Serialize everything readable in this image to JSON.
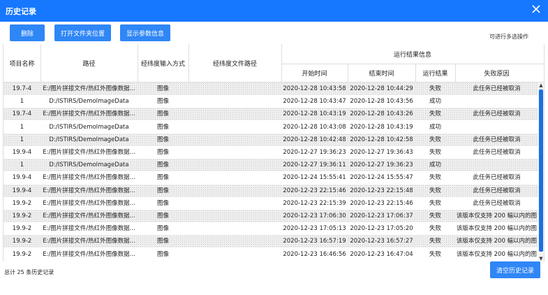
{
  "window": {
    "title": "历史记录",
    "close_icon": "close-icon"
  },
  "toolbar": {
    "delete_label": "删除",
    "open_folder_label": "打开文件夹位置",
    "show_params_label": "显示参数信息",
    "hint": "可进行多选操作"
  },
  "table": {
    "headers": {
      "project_name": "项目名称",
      "path": "路径",
      "latlon_input": "经纬度输入方式",
      "latlon_file": "经纬度文件路径",
      "result_group": "运行结果信息",
      "start_time": "开始时间",
      "end_time": "结束时间",
      "result": "运行结果",
      "failure_reason": "失败原因"
    },
    "rows": [
      {
        "name": "19.7-4",
        "path": "E:/图片拼接文件/热红外图像数据...",
        "input": "图像",
        "file": "",
        "start": "2020-12-28 10:43:58",
        "end": "2020-12-28 10:44:29",
        "result": "失败",
        "reason": "此任务已经被取消"
      },
      {
        "name": "1",
        "path": "D:/ISTIRS/DemoImageData",
        "input": "图像",
        "file": "",
        "start": "2020-12-28 10:43:47",
        "end": "2020-12-28 10:43:56",
        "result": "成功",
        "reason": ""
      },
      {
        "name": "19.7-4",
        "path": "E:/图片拼接文件/热红外图像数据...",
        "input": "图像",
        "file": "",
        "start": "2020-12-28 10:43:19",
        "end": "2020-12-28 10:43:26",
        "result": "失败",
        "reason": "此任务已经被取消"
      },
      {
        "name": "1",
        "path": "D:/ISTIRS/DemoImageData",
        "input": "图像",
        "file": "",
        "start": "2020-12-28 10:43:08",
        "end": "2020-12-28 10:43:19",
        "result": "成功",
        "reason": ""
      },
      {
        "name": "1",
        "path": "D:/ISTIRS/DemoImageData",
        "input": "图像",
        "file": "",
        "start": "2020-12-28 10:42:48",
        "end": "2020-12-28 10:42:58",
        "result": "失败",
        "reason": "此任务已经被取消"
      },
      {
        "name": "19.9-4",
        "path": "E:/图片拼接文件/热红外图像数据...",
        "input": "图像",
        "file": "",
        "start": "2020-12-27 19:36:23",
        "end": "2020-12-27 19:36:43",
        "result": "失败",
        "reason": "此任务已经被取消"
      },
      {
        "name": "1",
        "path": "D:/ISTIRS/DemoImageData",
        "input": "图像",
        "file": "",
        "start": "2020-12-27 19:36:11",
        "end": "2020-12-27 19:36:23",
        "result": "成功",
        "reason": ""
      },
      {
        "name": "19.9-4",
        "path": "E:/图片拼接文件/热红外图像数据...",
        "input": "图像",
        "file": "",
        "start": "2020-12-24 15:55:41",
        "end": "2020-12-24 15:55:47",
        "result": "失败",
        "reason": "此任务已经被取消"
      },
      {
        "name": "19.9-4",
        "path": "E:/图片拼接文件/热红外图像数据...",
        "input": "图像",
        "file": "",
        "start": "2020-12-23 22:15:46",
        "end": "2020-12-23 22:15:48",
        "result": "失败",
        "reason": "此任务已经被取消"
      },
      {
        "name": "19.9-2",
        "path": "E:/图片拼接文件/热红外图像数据...",
        "input": "图像",
        "file": "",
        "start": "2020-12-23 22:15:39",
        "end": "2020-12-23 22:15:46",
        "result": "失败",
        "reason": "此任务已经被取消"
      },
      {
        "name": "19.9-2",
        "path": "E:/图片拼接文件/热红外图像数据...",
        "input": "图像",
        "file": "",
        "start": "2020-12-23 17:06:30",
        "end": "2020-12-23 17:06:37",
        "result": "失败",
        "reason": "该版本仅支持 200 幅以内的图"
      },
      {
        "name": "19.9-2",
        "path": "E:/图片拼接文件/热红外图像数据...",
        "input": "图像",
        "file": "",
        "start": "2020-12-23 17:05:13",
        "end": "2020-12-23 17:05:20",
        "result": "失败",
        "reason": "该版本仅支持 200 幅以内的图"
      },
      {
        "name": "19.9-2",
        "path": "E:/图片拼接文件/热红外图像数据...",
        "input": "图像",
        "file": "",
        "start": "2020-12-23 16:57:19",
        "end": "2020-12-23 16:57:27",
        "result": "失败",
        "reason": "该版本仅支持 200 幅以内的图"
      },
      {
        "name": "19.9-2",
        "path": "E:/图片拼接文件/热红外图像数据...",
        "input": "图像",
        "file": "",
        "start": "2020-12-23 16:46:56",
        "end": "2020-12-23 16:47:04",
        "result": "失败",
        "reason": "该版本仅支持 200 幅以内的图"
      }
    ]
  },
  "footer": {
    "total": "总计 25 条历史记录",
    "clear_label": "清空历史记录"
  },
  "colors": {
    "accent": "#1677ff",
    "button": "#2f86f6",
    "scroll_thumb": "#1b6fe0"
  }
}
